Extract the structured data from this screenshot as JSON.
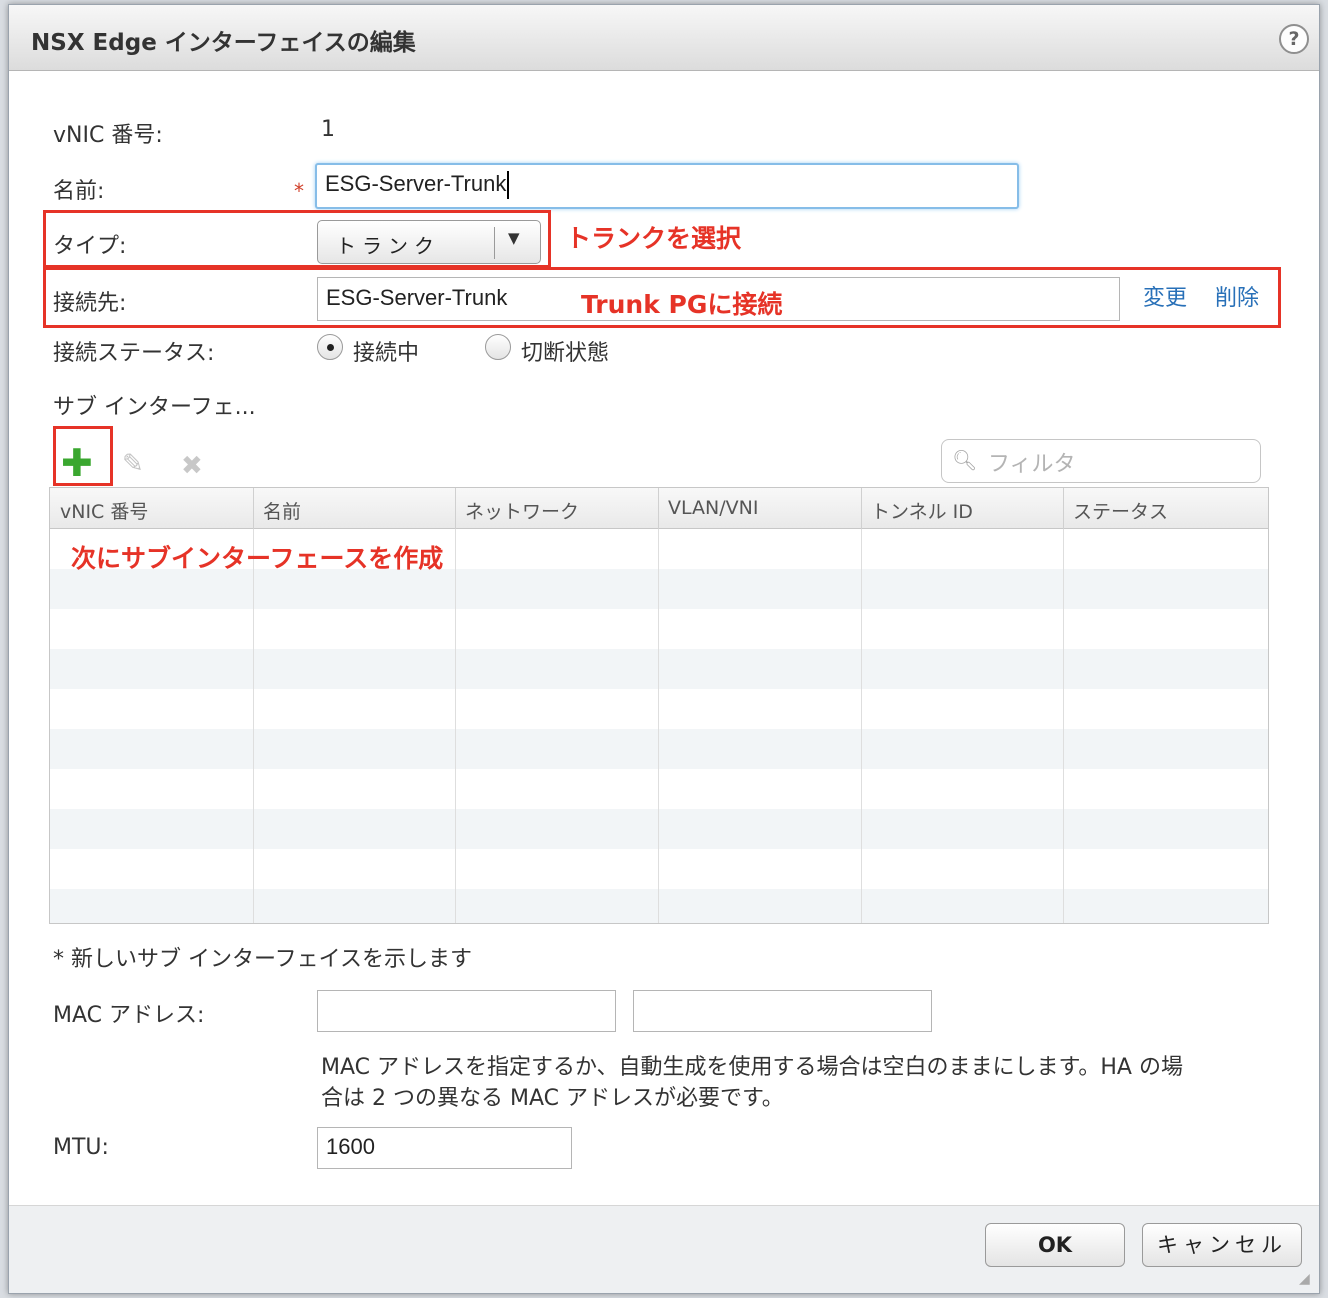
{
  "dialog": {
    "title": "NSX Edge インターフェイスの編集",
    "help": "?"
  },
  "form": {
    "vnic_label": "vNIC 番号:",
    "vnic_value": "1",
    "name_label": "名前:",
    "name_required": "*",
    "name_value": "ESG-Server-Trunk",
    "type_label": "タイプ:",
    "type_value": "トランク",
    "connected_label": "接続先:",
    "connected_value": "ESG-Server-Trunk",
    "change_link": "変更",
    "delete_link": "削除",
    "status_label": "接続ステータス:",
    "status_options": [
      "接続中",
      "切断状態"
    ],
    "status_selected": "接続中",
    "subif_label": "サブ インターフェ...",
    "filter_placeholder": "フィルタ",
    "note": "* 新しいサブ インターフェイスを示します",
    "mac_label": "MAC アドレス:",
    "mac_value_1": "",
    "mac_value_2": "",
    "mac_help_line1": "MAC アドレスを指定するか、自動生成を使用する場合は空白のままにします。HA の場",
    "mac_help_line2": "合は 2 つの異なる MAC アドレスが必要です。",
    "mtu_label": "MTU:",
    "mtu_value": "1600"
  },
  "grid": {
    "columns": [
      "vNIC 番号",
      "名前",
      "ネットワーク",
      "VLAN/VNI",
      "トンネル ID",
      "ステータス"
    ]
  },
  "annotations": {
    "type_note": "トランクを選択",
    "connect_note": "Trunk PGに接続",
    "create_note": "次にサブインターフェースを作成"
  },
  "buttons": {
    "ok": "OK",
    "cancel": "キャンセル"
  },
  "icons": {
    "add": "plus-icon",
    "edit": "pencil-icon",
    "delete": "delete-icon",
    "search": "search-icon"
  },
  "colors": {
    "annotation": "#e63327",
    "link": "#2870b8",
    "add_icon": "#3aa72f"
  }
}
